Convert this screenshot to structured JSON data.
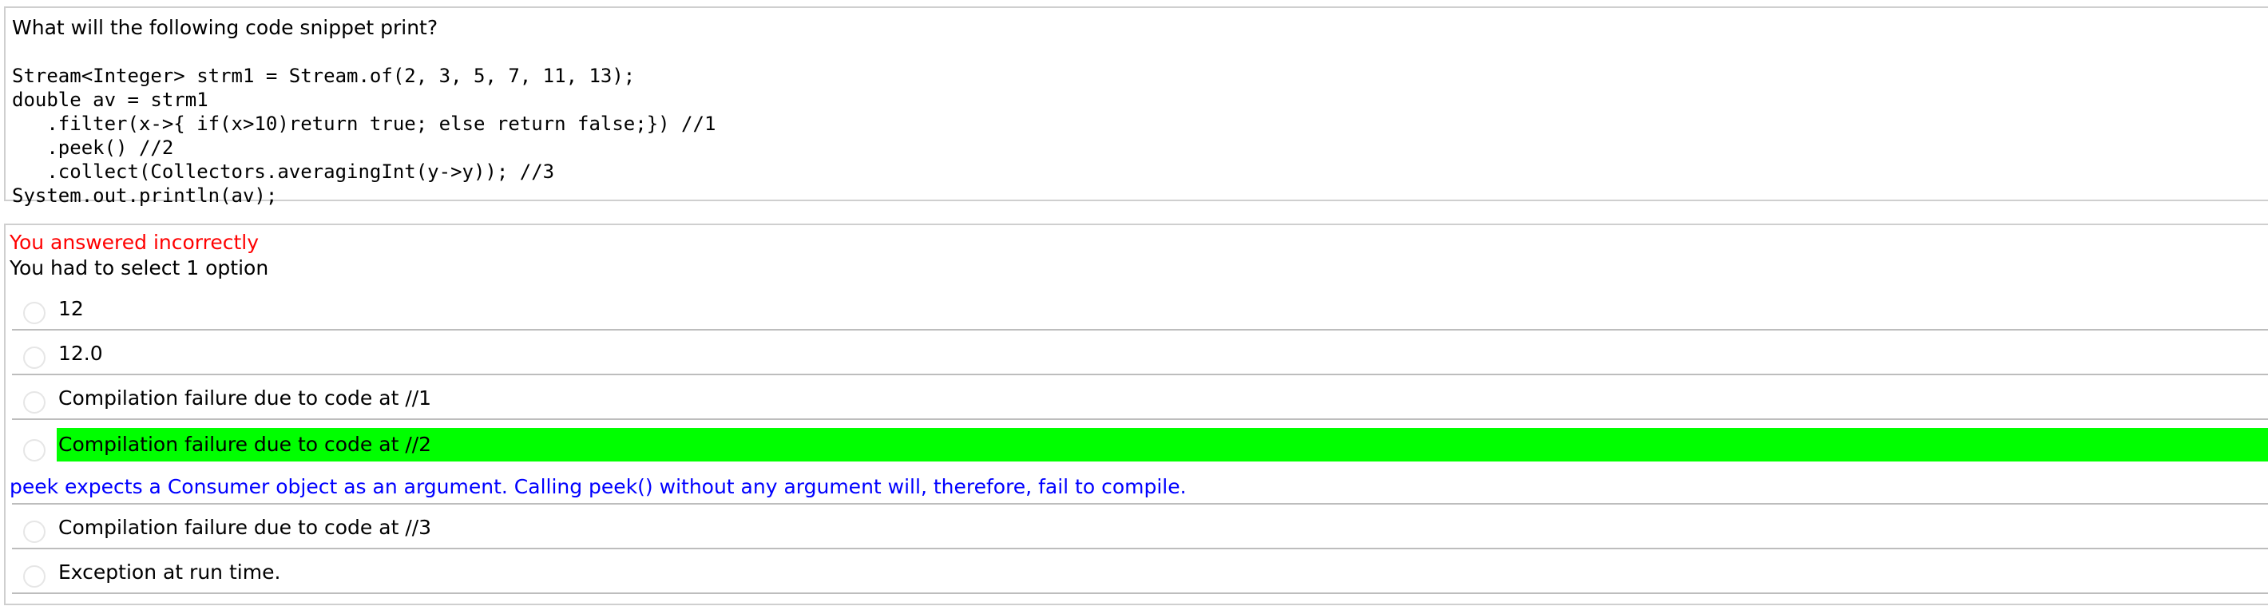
{
  "question": {
    "prompt": "What will the following code snippet print?",
    "code_lines": [
      "Stream<Integer> strm1 = Stream.of(2, 3, 5, 7, 11, 13);",
      "double av = strm1",
      "   .filter(x->{ if(x>10)return true; else return false;}) //1",
      "   .peek() //2",
      "   .collect(Collectors.averagingInt(y->y)); //3",
      "System.out.println(av);"
    ]
  },
  "answer": {
    "result": "You answered incorrectly",
    "instruction": "You had to select 1 option",
    "options": [
      {
        "label": "12",
        "correct": false
      },
      {
        "label": "12.0",
        "correct": false
      },
      {
        "label": "Compilation failure due to code at //1",
        "correct": false
      },
      {
        "label": "Compilation failure due to code at //2",
        "correct": true
      },
      {
        "label": "Compilation failure due to code at //3",
        "correct": false
      },
      {
        "label": "Exception at run time.",
        "correct": false
      }
    ],
    "explanation": "peek expects a Consumer object as an argument. Calling peek() without any argument will, therefore, fail to compile."
  },
  "colors": {
    "incorrect_text": "#ff0000",
    "correct_highlight": "#00ff00",
    "explanation_text": "#0000ff"
  }
}
